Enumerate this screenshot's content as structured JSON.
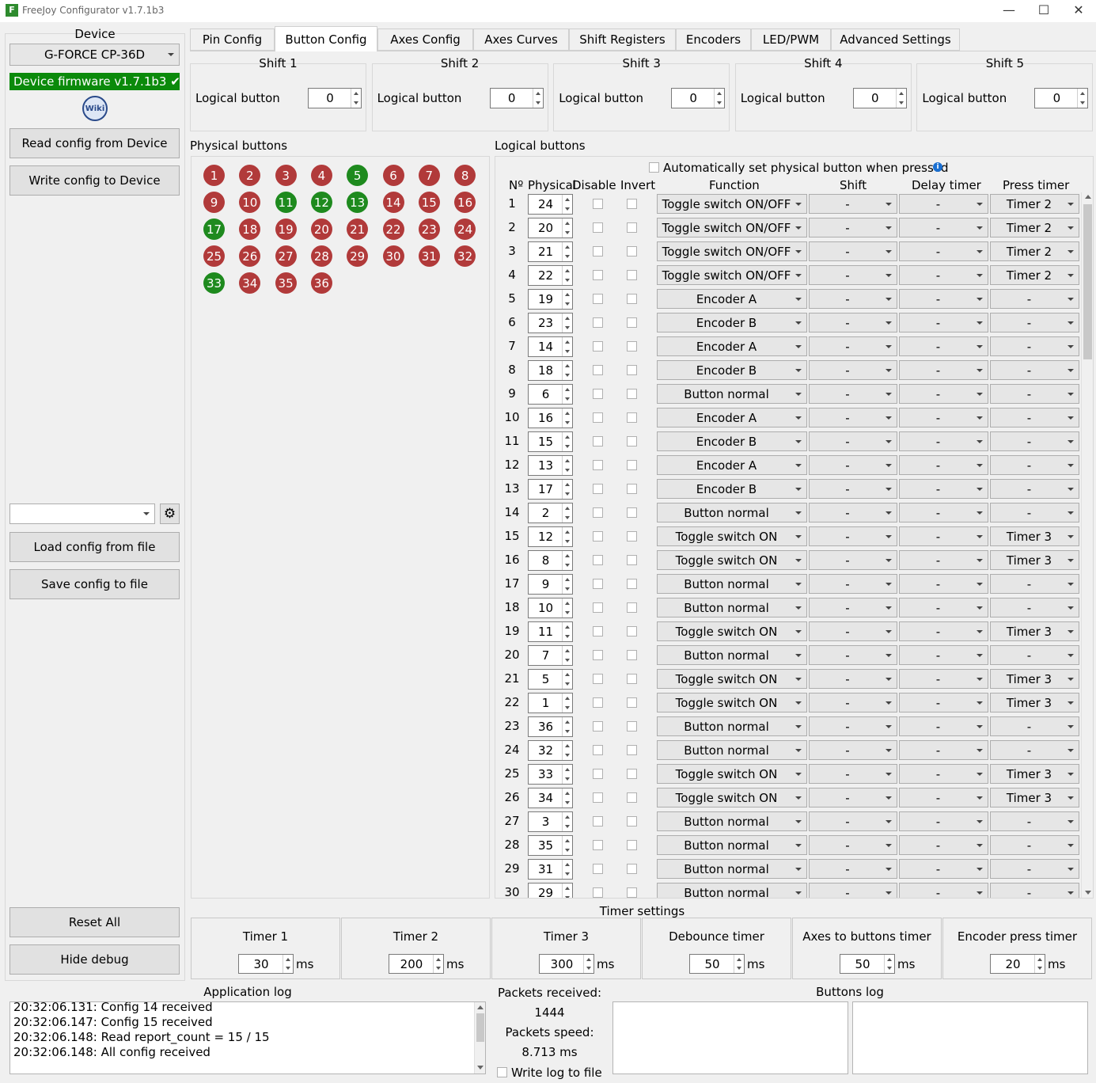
{
  "window": {
    "title": "FreeJoy Configurator v1.7.1b3",
    "icon_letter": "F",
    "minimize": "—",
    "maximize": "☐",
    "close": "✕"
  },
  "sidebar": {
    "device_label": "Device",
    "device_value": "G-FORCE CP-36D",
    "firmware": "Device firmware v1.7.1b3 ✔",
    "wiki_label": "Wiki",
    "read_btn": "Read config from Device",
    "write_btn": "Write config to Device",
    "config_value": "",
    "load_btn": "Load config from file",
    "save_btn": "Save config to file",
    "reset_btn": "Reset All",
    "debug_btn": "Hide debug"
  },
  "tabs": [
    "Pin Config",
    "Button Config",
    "Axes Config",
    "Axes Curves",
    "Shift Registers",
    "Encoders",
    "LED/PWM",
    "Advanced Settings"
  ],
  "active_tab": "Button Config",
  "shifts": [
    {
      "title": "Shift 1",
      "label": "Logical button",
      "value": "0"
    },
    {
      "title": "Shift 2",
      "label": "Logical button",
      "value": "0"
    },
    {
      "title": "Shift 3",
      "label": "Logical button",
      "value": "0"
    },
    {
      "title": "Shift 4",
      "label": "Logical button",
      "value": "0"
    },
    {
      "title": "Shift 5",
      "label": "Logical button",
      "value": "0"
    }
  ],
  "physical": {
    "title": "Physical buttons",
    "colors": {
      "off": "#b13a3a",
      "on": "#1e8a1e"
    },
    "buttons": [
      {
        "n": "1",
        "on": false
      },
      {
        "n": "2",
        "on": false
      },
      {
        "n": "3",
        "on": false
      },
      {
        "n": "4",
        "on": false
      },
      {
        "n": "5",
        "on": true
      },
      {
        "n": "6",
        "on": false
      },
      {
        "n": "7",
        "on": false
      },
      {
        "n": "8",
        "on": false
      },
      {
        "n": "9",
        "on": false
      },
      {
        "n": "10",
        "on": false
      },
      {
        "n": "11",
        "on": true
      },
      {
        "n": "12",
        "on": true
      },
      {
        "n": "13",
        "on": true
      },
      {
        "n": "14",
        "on": false
      },
      {
        "n": "15",
        "on": false
      },
      {
        "n": "16",
        "on": false
      },
      {
        "n": "17",
        "on": true
      },
      {
        "n": "18",
        "on": false
      },
      {
        "n": "19",
        "on": false
      },
      {
        "n": "20",
        "on": false
      },
      {
        "n": "21",
        "on": false
      },
      {
        "n": "22",
        "on": false
      },
      {
        "n": "23",
        "on": false
      },
      {
        "n": "24",
        "on": false
      },
      {
        "n": "25",
        "on": false
      },
      {
        "n": "26",
        "on": false
      },
      {
        "n": "27",
        "on": false
      },
      {
        "n": "28",
        "on": false
      },
      {
        "n": "29",
        "on": false
      },
      {
        "n": "30",
        "on": false
      },
      {
        "n": "31",
        "on": false
      },
      {
        "n": "32",
        "on": false
      },
      {
        "n": "33",
        "on": true
      },
      {
        "n": "34",
        "on": false
      },
      {
        "n": "35",
        "on": false
      },
      {
        "n": "36",
        "on": false
      }
    ]
  },
  "logical": {
    "title": "Logical buttons",
    "auto_set": "Automatically set physical button when pressed",
    "headers": {
      "no": "Nº",
      "physical": "Physical",
      "disable": "Disable",
      "invert": "Invert",
      "function": "Function",
      "shift": "Shift",
      "delay": "Delay timer",
      "press": "Press timer"
    },
    "rows": [
      {
        "no": "1",
        "phys": "24",
        "func": "Toggle switch ON/OFF",
        "shift": "-",
        "delay": "-",
        "press": "Timer 2"
      },
      {
        "no": "2",
        "phys": "20",
        "func": "Toggle switch ON/OFF",
        "shift": "-",
        "delay": "-",
        "press": "Timer 2"
      },
      {
        "no": "3",
        "phys": "21",
        "func": "Toggle switch ON/OFF",
        "shift": "-",
        "delay": "-",
        "press": "Timer 2"
      },
      {
        "no": "4",
        "phys": "22",
        "func": "Toggle switch ON/OFF",
        "shift": "-",
        "delay": "-",
        "press": "Timer 2"
      },
      {
        "no": "5",
        "phys": "19",
        "func": "Encoder A",
        "shift": "-",
        "delay": "-",
        "press": "-"
      },
      {
        "no": "6",
        "phys": "23",
        "func": "Encoder B",
        "shift": "-",
        "delay": "-",
        "press": "-"
      },
      {
        "no": "7",
        "phys": "14",
        "func": "Encoder A",
        "shift": "-",
        "delay": "-",
        "press": "-"
      },
      {
        "no": "8",
        "phys": "18",
        "func": "Encoder B",
        "shift": "-",
        "delay": "-",
        "press": "-"
      },
      {
        "no": "9",
        "phys": "6",
        "func": "Button normal",
        "shift": "-",
        "delay": "-",
        "press": "-"
      },
      {
        "no": "10",
        "phys": "16",
        "func": "Encoder A",
        "shift": "-",
        "delay": "-",
        "press": "-"
      },
      {
        "no": "11",
        "phys": "15",
        "func": "Encoder B",
        "shift": "-",
        "delay": "-",
        "press": "-"
      },
      {
        "no": "12",
        "phys": "13",
        "func": "Encoder A",
        "shift": "-",
        "delay": "-",
        "press": "-"
      },
      {
        "no": "13",
        "phys": "17",
        "func": "Encoder B",
        "shift": "-",
        "delay": "-",
        "press": "-"
      },
      {
        "no": "14",
        "phys": "2",
        "func": "Button normal",
        "shift": "-",
        "delay": "-",
        "press": "-"
      },
      {
        "no": "15",
        "phys": "12",
        "func": "Toggle switch ON",
        "shift": "-",
        "delay": "-",
        "press": "Timer 3"
      },
      {
        "no": "16",
        "phys": "8",
        "func": "Toggle switch ON",
        "shift": "-",
        "delay": "-",
        "press": "Timer 3"
      },
      {
        "no": "17",
        "phys": "9",
        "func": "Button normal",
        "shift": "-",
        "delay": "-",
        "press": "-"
      },
      {
        "no": "18",
        "phys": "10",
        "func": "Button normal",
        "shift": "-",
        "delay": "-",
        "press": "-"
      },
      {
        "no": "19",
        "phys": "11",
        "func": "Toggle switch ON",
        "shift": "-",
        "delay": "-",
        "press": "Timer 3"
      },
      {
        "no": "20",
        "phys": "7",
        "func": "Button normal",
        "shift": "-",
        "delay": "-",
        "press": "-"
      },
      {
        "no": "21",
        "phys": "5",
        "func": "Toggle switch ON",
        "shift": "-",
        "delay": "-",
        "press": "Timer 3"
      },
      {
        "no": "22",
        "phys": "1",
        "func": "Toggle switch ON",
        "shift": "-",
        "delay": "-",
        "press": "Timer 3"
      },
      {
        "no": "23",
        "phys": "36",
        "func": "Button normal",
        "shift": "-",
        "delay": "-",
        "press": "-"
      },
      {
        "no": "24",
        "phys": "32",
        "func": "Button normal",
        "shift": "-",
        "delay": "-",
        "press": "-"
      },
      {
        "no": "25",
        "phys": "33",
        "func": "Toggle switch ON",
        "shift": "-",
        "delay": "-",
        "press": "Timer 3"
      },
      {
        "no": "26",
        "phys": "34",
        "func": "Toggle switch ON",
        "shift": "-",
        "delay": "-",
        "press": "Timer 3"
      },
      {
        "no": "27",
        "phys": "3",
        "func": "Button normal",
        "shift": "-",
        "delay": "-",
        "press": "-"
      },
      {
        "no": "28",
        "phys": "35",
        "func": "Button normal",
        "shift": "-",
        "delay": "-",
        "press": "-"
      },
      {
        "no": "29",
        "phys": "31",
        "func": "Button normal",
        "shift": "-",
        "delay": "-",
        "press": "-"
      },
      {
        "no": "30",
        "phys": "29",
        "func": "Button normal",
        "shift": "-",
        "delay": "-",
        "press": "-"
      }
    ]
  },
  "timer_settings": {
    "title": "Timer settings",
    "unit": "ms",
    "timers": [
      {
        "label": "Timer 1",
        "value": "30"
      },
      {
        "label": "Timer 2",
        "value": "200"
      },
      {
        "label": "Timer 3",
        "value": "300"
      },
      {
        "label": "Debounce timer",
        "value": "50"
      },
      {
        "label": "Axes to buttons timer",
        "value": "50"
      },
      {
        "label": "Encoder press timer",
        "value": "20"
      }
    ]
  },
  "app_log": {
    "title": "Application log",
    "lines": [
      "20:32:06.131: Config 14 received",
      "20:32:06.147: Config 15 received",
      "20:32:06.148: Read report_count = 15 / 15",
      "20:32:06.148: All config received"
    ]
  },
  "stats": {
    "received_label": "Packets received:",
    "received_value": "1444",
    "speed_label": "Packets speed:",
    "speed_value": "8.713 ms",
    "write_log": "Write log to file"
  },
  "buttons_log": {
    "title": "Buttons log"
  }
}
